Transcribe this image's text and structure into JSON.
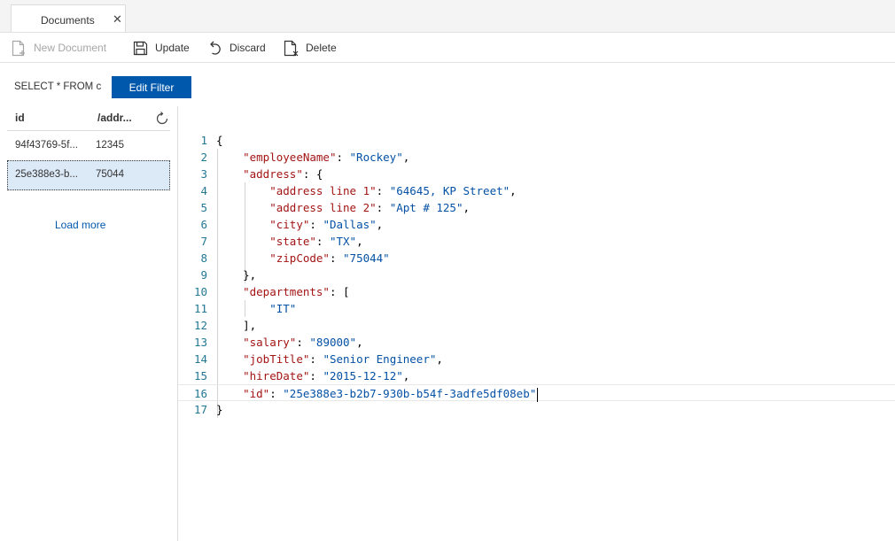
{
  "tab": {
    "label": "Documents",
    "close": "✕"
  },
  "toolbar": {
    "new_document": "New Document",
    "update": "Update",
    "discard": "Discard",
    "delete": "Delete"
  },
  "filter": {
    "query": "SELECT * FROM c",
    "button": "Edit Filter"
  },
  "list": {
    "headers": [
      "id",
      "/addr..."
    ],
    "rows": [
      {
        "id": "94f43769-5f...",
        "value": "12345"
      },
      {
        "id": "25e388e3-b...",
        "value": "75044"
      }
    ],
    "load_more": "Load more"
  },
  "editor": {
    "lines": [
      {
        "n": "1",
        "indent": 0,
        "key": "",
        "val": "",
        "pre": "{",
        "post": ""
      },
      {
        "n": "2",
        "indent": 1,
        "key": "\"employeeName\"",
        "val": "\"Rockey\"",
        "pre": "",
        "post": ","
      },
      {
        "n": "3",
        "indent": 1,
        "key": "\"address\"",
        "val": "",
        "pre": "",
        "post": " {"
      },
      {
        "n": "4",
        "indent": 2,
        "key": "\"address line 1\"",
        "val": "\"64645, KP Street\"",
        "pre": "",
        "post": ","
      },
      {
        "n": "5",
        "indent": 2,
        "key": "\"address line 2\"",
        "val": "\"Apt # 125\"",
        "pre": "",
        "post": ","
      },
      {
        "n": "6",
        "indent": 2,
        "key": "\"city\"",
        "val": "\"Dallas\"",
        "pre": "",
        "post": ","
      },
      {
        "n": "7",
        "indent": 2,
        "key": "\"state\"",
        "val": "\"TX\"",
        "pre": "",
        "post": ","
      },
      {
        "n": "8",
        "indent": 2,
        "key": "\"zipCode\"",
        "val": "\"75044\"",
        "pre": "",
        "post": ""
      },
      {
        "n": "9",
        "indent": 1,
        "key": "",
        "val": "",
        "pre": "},",
        "post": ""
      },
      {
        "n": "10",
        "indent": 1,
        "key": "\"departments\"",
        "val": "",
        "pre": "",
        "post": " ["
      },
      {
        "n": "11",
        "indent": 2,
        "key": "",
        "val": "\"IT\"",
        "pre": "",
        "post": ""
      },
      {
        "n": "12",
        "indent": 1,
        "key": "",
        "val": "",
        "pre": "],",
        "post": ""
      },
      {
        "n": "13",
        "indent": 1,
        "key": "\"salary\"",
        "val": "\"89000\"",
        "pre": "",
        "post": ","
      },
      {
        "n": "14",
        "indent": 1,
        "key": "\"jobTitle\"",
        "val": "\"Senior Engineer\"",
        "pre": "",
        "post": ","
      },
      {
        "n": "15",
        "indent": 1,
        "key": "\"hireDate\"",
        "val": "\"2015-12-12\"",
        "pre": "",
        "post": ","
      },
      {
        "n": "16",
        "indent": 1,
        "key": "\"id\"",
        "val": "\"25e388e3-b2b7-930b-b54f-3adfe5df08eb\"",
        "pre": "",
        "post": "",
        "current": true
      },
      {
        "n": "17",
        "indent": 0,
        "key": "",
        "val": "",
        "pre": "}",
        "post": ""
      }
    ]
  },
  "colors": {
    "accent": "#0058ad",
    "selected_row": "#dce9f7",
    "json_key": "#a31515",
    "json_string": "#0451a5",
    "line_number": "#237893"
  }
}
